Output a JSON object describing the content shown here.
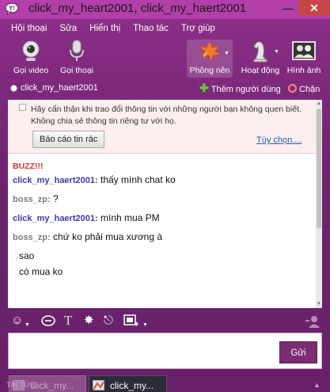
{
  "window": {
    "title": "click_my_heart2001, click_my_haert2001",
    "minimize": "—",
    "close": "✕"
  },
  "menu": [
    "Hội thoại",
    "Sửa",
    "Hiển thị",
    "Thao tác",
    "Trợ giúp"
  ],
  "toolbar": {
    "video_call": "Gọi video",
    "voice_call": "Gọi thoại",
    "theme": "Phông nền",
    "activities": "Hoạt động",
    "display_image": "Hình ảnh"
  },
  "status": {
    "contact": "click_my_haert2001",
    "add_user": "Thêm người dùng",
    "block": "Chặn"
  },
  "warning": {
    "text": "Hãy cẩn thận khi trao đổi thông tin với những người bạn không quen biết. Không chia sẻ thông tin riêng tư với họ.",
    "report_button": "Báo cáo tin rác",
    "options_link": "Tùy chọn...."
  },
  "conversation": {
    "buzz": "BUZZ!!!",
    "messages": [
      {
        "sender": "click_my_haert2001:",
        "text": "thấy mình chat ko"
      },
      {
        "sender": "boss_zp:",
        "text": "?"
      },
      {
        "sender": "click_my_haert2001:",
        "text": "mình mua PM"
      },
      {
        "sender": "boss_zp:",
        "text": "chứ ko phải mua xương à"
      }
    ],
    "continuations": [
      "sao",
      "có mua ko"
    ]
  },
  "compose": {
    "value": "",
    "send": "Gửi"
  },
  "tabs": [
    {
      "label": "click_my..."
    },
    {
      "label": "click_my..."
    }
  ],
  "footer": {
    "news": "TIN TỨC",
    "arrow": "▲"
  },
  "colors": {
    "titlebar": "#b33fa9",
    "frame": "#6e2470",
    "close_button": "#c84545",
    "sender_self": "#3a3ab3",
    "sender_other": "#7d7d7d",
    "buzz": "#e23030",
    "link": "#1a5bb8"
  }
}
